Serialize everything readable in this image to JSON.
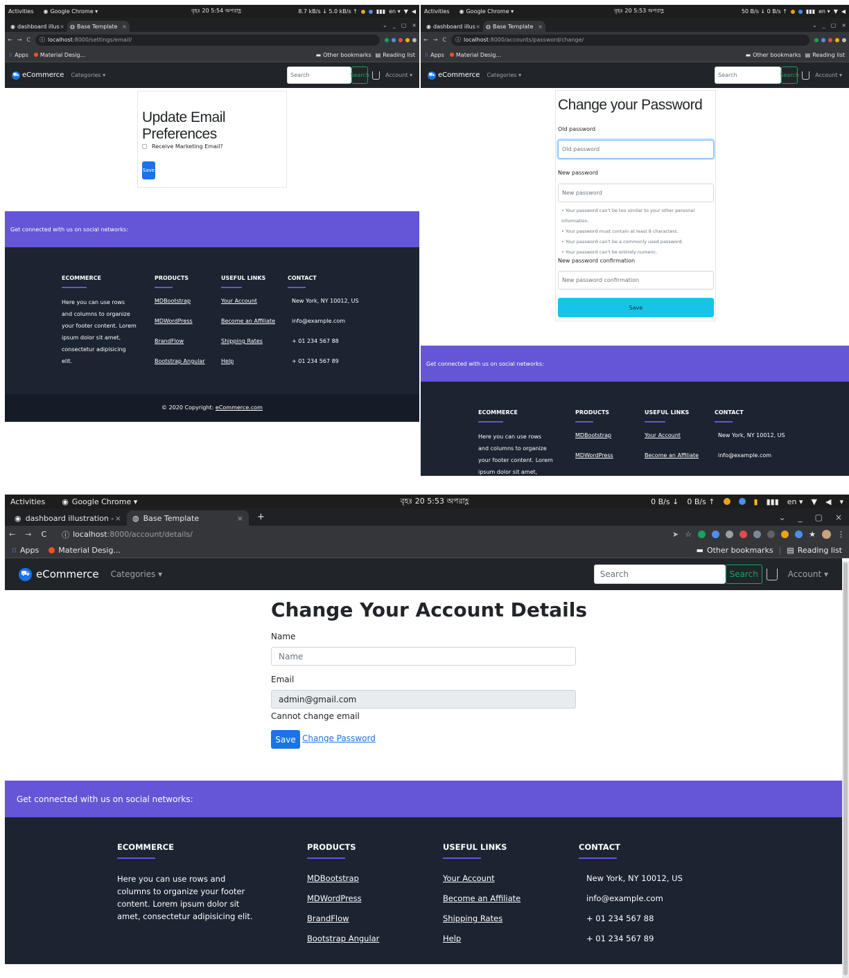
{
  "os_bar": {
    "activities": "Activities",
    "app": "Google Chrome ▾",
    "clock_top_left": "বৃহঃ 20 5:54 অপরাহ্ণ",
    "clock_top_right": "বৃহঃ 20 5:53 অপরাহ্ণ",
    "clock_bottom": "বৃহঃ 20 5:53 অপরাহ্ণ",
    "net_top_left": "8.7 kB/s ↓ 5.0 kB/s ↑",
    "net_top_right": "50 B/s ↓ 0 B/s ↑",
    "net_bottom_down": "0 B/s ↓",
    "net_bottom_up": "0 B/s ↑",
    "lang": "en ▾"
  },
  "browser": {
    "tab1": "dashboard illustration - C",
    "tab2": "Base Template",
    "close": "×",
    "new_tab": "+",
    "url_host": "localhost",
    "url_port": ":8000",
    "url_path_email": "/settings/email/",
    "url_path_password": "/accounts/password/change/",
    "url_path_details": "/account/details/",
    "bookmarks": {
      "apps": "Apps",
      "material": "Material Desig...",
      "other": "Other bookmarks",
      "reading": "Reading list"
    }
  },
  "navbar": {
    "brand": "eCommerce",
    "categories": "Categories ▾",
    "search_placeholder": "Search",
    "search_button": "Search",
    "account": "Account ▾"
  },
  "email_prefs": {
    "title": "Update Email Preferences",
    "checkbox_label": "Receive Marketing Email?",
    "save": "Save"
  },
  "password_change": {
    "title": "Change your Password",
    "old_label": "Old password",
    "old_placeholder": "Old password",
    "new_label": "New password",
    "new_placeholder": "New password",
    "hints": [
      "Your password can't be too similar to your other personal information.",
      "Your password must contain at least 8 characters.",
      "Your password can't be a commonly used password.",
      "Your password can't be entirely numeric."
    ],
    "confirm_label": "New password confirmation",
    "confirm_placeholder": "New password confirmation",
    "save": "Save"
  },
  "account_details": {
    "title": "Change Your Account Details",
    "name_label": "Name",
    "name_placeholder": "Name",
    "email_label": "Email",
    "email_value": "admin@gmail.com",
    "email_note": "Cannot change email",
    "save": "Save",
    "change_password": "Change Password"
  },
  "footer": {
    "social": "Get connected with us on social networks:",
    "ecommerce_title": "ECOMMERCE",
    "ecommerce_text": "Here you can use rows and columns to organize your footer content. Lorem ipsum dolor sit amet, consectetur adipisicing elit.",
    "products_title": "PRODUCTS",
    "products": [
      "MDBootstrap",
      "MDWordPress",
      "BrandFlow",
      "Bootstrap Angular"
    ],
    "links_title": "USEFUL LINKS",
    "links": [
      "Your Account",
      "Become an Affiliate",
      "Shipping Rates",
      "Help"
    ],
    "contact_title": "CONTACT",
    "contact": [
      "New York, NY 10012, US",
      "info@example.com",
      "+ 01 234 567 88",
      "+ 01 234 567 89"
    ],
    "copyright": "© 2020 Copyright:",
    "copyright_link": "eCommerce.com"
  }
}
